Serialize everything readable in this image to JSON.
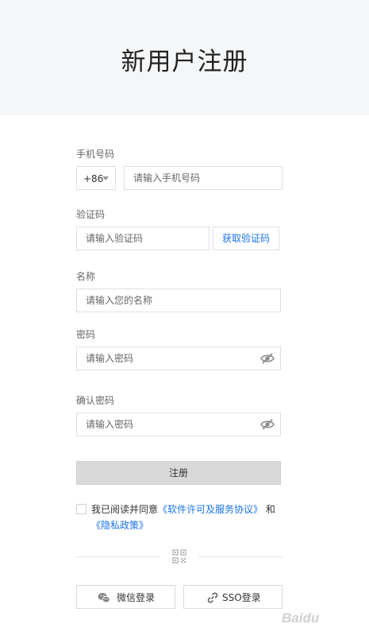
{
  "header": {
    "title": "新用户注册"
  },
  "phone": {
    "label": "手机号码",
    "country_code": "+86",
    "placeholder": "请输入手机号码"
  },
  "code": {
    "label": "验证码",
    "placeholder": "请输入验证码",
    "get_code_label": "获取验证码"
  },
  "name": {
    "label": "名称",
    "placeholder": "请输入您的名称"
  },
  "password": {
    "label": "密码",
    "placeholder": "请输入密码"
  },
  "confirm": {
    "label": "确认密码",
    "placeholder": "请输入密码"
  },
  "register": {
    "label": "注册"
  },
  "agreement": {
    "prefix": "我已阅读并同意",
    "license": "《软件许可及服务协议》",
    "conj": "和",
    "privacy": "《隐私政策》"
  },
  "alt_login": {
    "wechat": "微信登录",
    "sso": "SSO登录",
    "wechat_icon": "wechat-icon",
    "sso_icon": "link-icon"
  },
  "watermark": {
    "text": "Baidu"
  },
  "colors": {
    "accent": "#1a73e8",
    "header_bg": "#f4f6f8",
    "button_disabled": "#d9d9d9",
    "border": "#dcdfe6"
  }
}
